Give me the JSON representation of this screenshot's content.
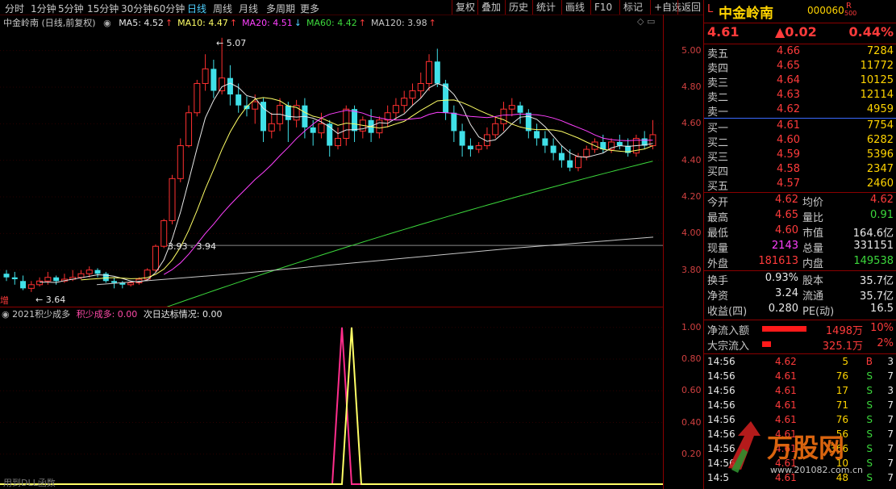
{
  "toolbar": {
    "periods": [
      "分时",
      "1分钟",
      "5分钟",
      "15分钟",
      "30分钟",
      "60分钟",
      "日线",
      "周线",
      "月线",
      "多周期",
      "更多"
    ],
    "active_period": "日线",
    "buttons": [
      "复权",
      "叠加",
      "历史",
      "统计",
      "画线",
      "F10",
      "标记",
      "+自选",
      "返回"
    ]
  },
  "main": {
    "title": "中金岭南 (日线,前复权)",
    "ma": [
      {
        "label": "MA5: 4.52",
        "arrow": "↑",
        "color": "#e8e8e8"
      },
      {
        "label": "MA10: 4.47",
        "arrow": "↑",
        "color": "#ffff66"
      },
      {
        "label": "MA20: 4.51",
        "arrow": "↓",
        "color": "#ff40ff"
      },
      {
        "label": "MA60: 4.42",
        "arrow": "↑",
        "color": "#3cd83c"
      },
      {
        "label": "MA120: 3.98",
        "arrow": "↑",
        "color": "#c8c8c8"
      }
    ],
    "high_label": "5.07",
    "low_label": "3.64",
    "mid_label": "3.93 - 3.94",
    "left_tag": "增"
  },
  "yaxis_main": [
    "5.00",
    "4.80",
    "4.60",
    "4.40",
    "4.20",
    "4.00",
    "3.80"
  ],
  "sub": {
    "title": "2021积少成多",
    "line1": "积少成多: 0.00",
    "line2": "次日达标情况: 0.00",
    "yaxis": [
      "1.00",
      "0.80",
      "0.60",
      "0.40",
      "0.20"
    ]
  },
  "footer": "用到DLL函数",
  "chart_data": {
    "type": "candlestick",
    "ylim": [
      3.6,
      5.1
    ],
    "candles": [
      [
        3.78,
        3.76,
        3.8,
        3.74
      ],
      [
        3.76,
        3.75,
        3.79,
        3.72
      ],
      [
        3.74,
        3.7,
        3.77,
        3.69
      ],
      [
        3.7,
        3.72,
        3.74,
        3.68
      ],
      [
        3.72,
        3.74,
        3.76,
        3.71
      ],
      [
        3.74,
        3.76,
        3.79,
        3.72
      ],
      [
        3.76,
        3.74,
        3.77,
        3.72
      ],
      [
        3.74,
        3.75,
        3.78,
        3.73
      ],
      [
        3.75,
        3.76,
        3.8,
        3.74
      ],
      [
        3.76,
        3.78,
        3.8,
        3.75
      ],
      [
        3.78,
        3.8,
        3.82,
        3.76
      ],
      [
        3.8,
        3.78,
        3.81,
        3.76
      ],
      [
        3.78,
        3.74,
        3.79,
        3.73
      ],
      [
        3.74,
        3.73,
        3.76,
        3.7
      ],
      [
        3.73,
        3.72,
        3.74,
        3.7
      ],
      [
        3.72,
        3.73,
        3.74,
        3.71
      ],
      [
        3.73,
        3.75,
        3.76,
        3.72
      ],
      [
        3.75,
        3.8,
        3.81,
        3.74
      ],
      [
        3.8,
        3.93,
        3.94,
        3.79
      ],
      [
        3.93,
        4.07,
        4.08,
        3.92
      ],
      [
        4.07,
        4.3,
        4.32,
        4.05
      ],
      [
        4.3,
        4.48,
        4.52,
        4.28
      ],
      [
        4.48,
        4.66,
        4.7,
        4.47
      ],
      [
        4.66,
        4.82,
        4.84,
        4.64
      ],
      [
        4.82,
        4.9,
        4.98,
        4.78
      ],
      [
        4.9,
        4.78,
        4.95,
        4.74
      ],
      [
        4.78,
        4.85,
        5.07,
        4.76
      ],
      [
        4.85,
        4.76,
        4.92,
        4.7
      ],
      [
        4.76,
        4.7,
        4.82,
        4.66
      ],
      [
        4.7,
        4.68,
        4.75,
        4.64
      ],
      [
        4.68,
        4.72,
        4.76,
        4.6
      ],
      [
        4.72,
        4.56,
        4.74,
        4.5
      ],
      [
        4.56,
        4.6,
        4.66,
        4.52
      ],
      [
        4.6,
        4.7,
        4.74,
        4.56
      ],
      [
        4.7,
        4.62,
        4.72,
        4.5
      ],
      [
        4.62,
        4.7,
        4.73,
        4.58
      ],
      [
        4.7,
        4.58,
        4.74,
        4.52
      ],
      [
        4.58,
        4.55,
        4.62,
        4.48
      ],
      [
        4.55,
        4.6,
        4.66,
        4.52
      ],
      [
        4.6,
        4.48,
        4.62,
        4.42
      ],
      [
        4.48,
        4.52,
        4.58,
        4.46
      ],
      [
        4.52,
        4.68,
        4.7,
        4.48
      ],
      [
        4.68,
        4.56,
        4.7,
        4.5
      ],
      [
        4.56,
        4.62,
        4.64,
        4.52
      ],
      [
        4.62,
        4.55,
        4.68,
        4.5
      ],
      [
        4.55,
        4.62,
        4.64,
        4.52
      ],
      [
        4.62,
        4.66,
        4.7,
        4.58
      ],
      [
        4.66,
        4.7,
        4.74,
        4.62
      ],
      [
        4.7,
        4.74,
        4.78,
        4.66
      ],
      [
        4.74,
        4.78,
        4.82,
        4.7
      ],
      [
        4.78,
        4.82,
        4.88,
        4.74
      ],
      [
        4.82,
        4.94,
        4.98,
        4.78
      ],
      [
        4.94,
        4.82,
        5.01,
        4.8
      ],
      [
        4.82,
        4.66,
        4.84,
        4.62
      ],
      [
        4.66,
        4.56,
        4.7,
        4.5
      ],
      [
        4.56,
        4.48,
        4.6,
        4.42
      ],
      [
        4.48,
        4.46,
        4.52,
        4.42
      ],
      [
        4.46,
        4.48,
        4.5,
        4.44
      ],
      [
        4.48,
        4.54,
        4.58,
        4.46
      ],
      [
        4.54,
        4.6,
        4.64,
        4.52
      ],
      [
        4.6,
        4.68,
        4.72,
        4.56
      ],
      [
        4.68,
        4.7,
        4.74,
        4.64
      ],
      [
        4.7,
        4.66,
        4.72,
        4.6
      ],
      [
        4.66,
        4.56,
        4.68,
        4.52
      ],
      [
        4.56,
        4.52,
        4.6,
        4.48
      ],
      [
        4.52,
        4.48,
        4.56,
        4.44
      ],
      [
        4.48,
        4.44,
        4.52,
        4.4
      ],
      [
        4.44,
        4.4,
        4.48,
        4.36
      ],
      [
        4.4,
        4.36,
        4.46,
        4.34
      ],
      [
        4.36,
        4.42,
        4.44,
        4.34
      ],
      [
        4.42,
        4.46,
        4.48,
        4.4
      ],
      [
        4.46,
        4.5,
        4.52,
        4.44
      ],
      [
        4.5,
        4.46,
        4.54,
        4.44
      ],
      [
        4.46,
        4.5,
        4.52,
        4.44
      ],
      [
        4.5,
        4.48,
        4.54,
        4.46
      ],
      [
        4.48,
        4.44,
        4.52,
        4.42
      ],
      [
        4.44,
        4.52,
        4.54,
        4.42
      ],
      [
        4.52,
        4.48,
        4.56,
        4.46
      ],
      [
        4.48,
        4.54,
        4.62,
        4.46
      ]
    ],
    "ma120": [
      3.72,
      3.78,
      3.85,
      3.92,
      3.98
    ]
  },
  "panel": {
    "code_prefix": "L",
    "name": "中金岭南",
    "code": "000060",
    "flag_r": "R",
    "flag_500": "500",
    "price": "4.61",
    "change": "▲0.02",
    "pct": "0.44%",
    "asks": [
      {
        "l": "卖五",
        "p": "4.66",
        "v": "7284"
      },
      {
        "l": "卖四",
        "p": "4.65",
        "v": "11772"
      },
      {
        "l": "卖三",
        "p": "4.64",
        "v": "10125"
      },
      {
        "l": "卖二",
        "p": "4.63",
        "v": "12114"
      },
      {
        "l": "卖一",
        "p": "4.62",
        "v": "4959"
      }
    ],
    "bids": [
      {
        "l": "买一",
        "p": "4.61",
        "v": "7754",
        "c": "red"
      },
      {
        "l": "买二",
        "p": "4.60",
        "v": "6282",
        "c": "red"
      },
      {
        "l": "买三",
        "p": "4.59",
        "v": "5396",
        "c": "wht"
      },
      {
        "l": "买四",
        "p": "4.58",
        "v": "2347",
        "c": "grn"
      },
      {
        "l": "买五",
        "p": "4.57",
        "v": "2460",
        "c": "grn"
      }
    ],
    "stats": [
      {
        "a": "今开",
        "av": "4.62",
        "ac": "red",
        "b": "均价",
        "bv": "4.62",
        "bc": "red"
      },
      {
        "a": "最高",
        "av": "4.65",
        "ac": "red",
        "b": "量比",
        "bv": "0.91",
        "bc": "grn"
      },
      {
        "a": "最低",
        "av": "4.60",
        "ac": "red",
        "b": "市值",
        "bv": "164.6亿",
        "bc": "wht"
      },
      {
        "a": "现量",
        "av": "2143",
        "ac": "mag",
        "b": "总量",
        "bv": "331151",
        "bc": "wht"
      },
      {
        "a": "外盘",
        "av": "181613",
        "ac": "red",
        "b": "内盘",
        "bv": "149538",
        "bc": "grn"
      }
    ],
    "stats2": [
      {
        "a": "换手",
        "av": "0.93%",
        "b": "股本",
        "bv": "35.7亿"
      },
      {
        "a": "净资",
        "av": "3.24",
        "b": "流通",
        "bv": "35.7亿"
      },
      {
        "a": "收益(四)",
        "av": "0.280",
        "b": "PE(动)",
        "bv": "16.5"
      }
    ],
    "flows": [
      {
        "label": "净流入额",
        "value": "1498万",
        "pct": "10%",
        "bar": 0.5
      },
      {
        "label": "大宗流入",
        "value": "325.1万",
        "pct": "2%",
        "bar": 0.1
      }
    ],
    "ticks": [
      {
        "t": "14:56",
        "p": "4.62",
        "v": "5",
        "s": "B"
      },
      {
        "t": "14:56",
        "p": "4.61",
        "v": "76",
        "s": "S"
      },
      {
        "t": "14:56",
        "p": "4.61",
        "v": "17",
        "s": "S"
      },
      {
        "t": "14:56",
        "p": "4.61",
        "v": "71",
        "s": "S"
      },
      {
        "t": "14:56",
        "p": "4.61",
        "v": "76",
        "s": "S"
      },
      {
        "t": "14:56",
        "p": "4.61",
        "v": "56",
        "s": "S"
      },
      {
        "t": "14:56",
        "p": "4.61",
        "v": "366",
        "s": "S"
      },
      {
        "t": "14:56",
        "p": "4.61",
        "v": "10",
        "s": "S"
      },
      {
        "t": "14:5",
        "p": "4.61",
        "v": "48",
        "s": "S"
      }
    ],
    "tick_counts": [
      "3",
      "7",
      "3",
      "7",
      "7",
      "7",
      "7",
      "7",
      "7"
    ],
    "watermark": "万股网",
    "watermark_url": "www.201082.com.cn"
  }
}
